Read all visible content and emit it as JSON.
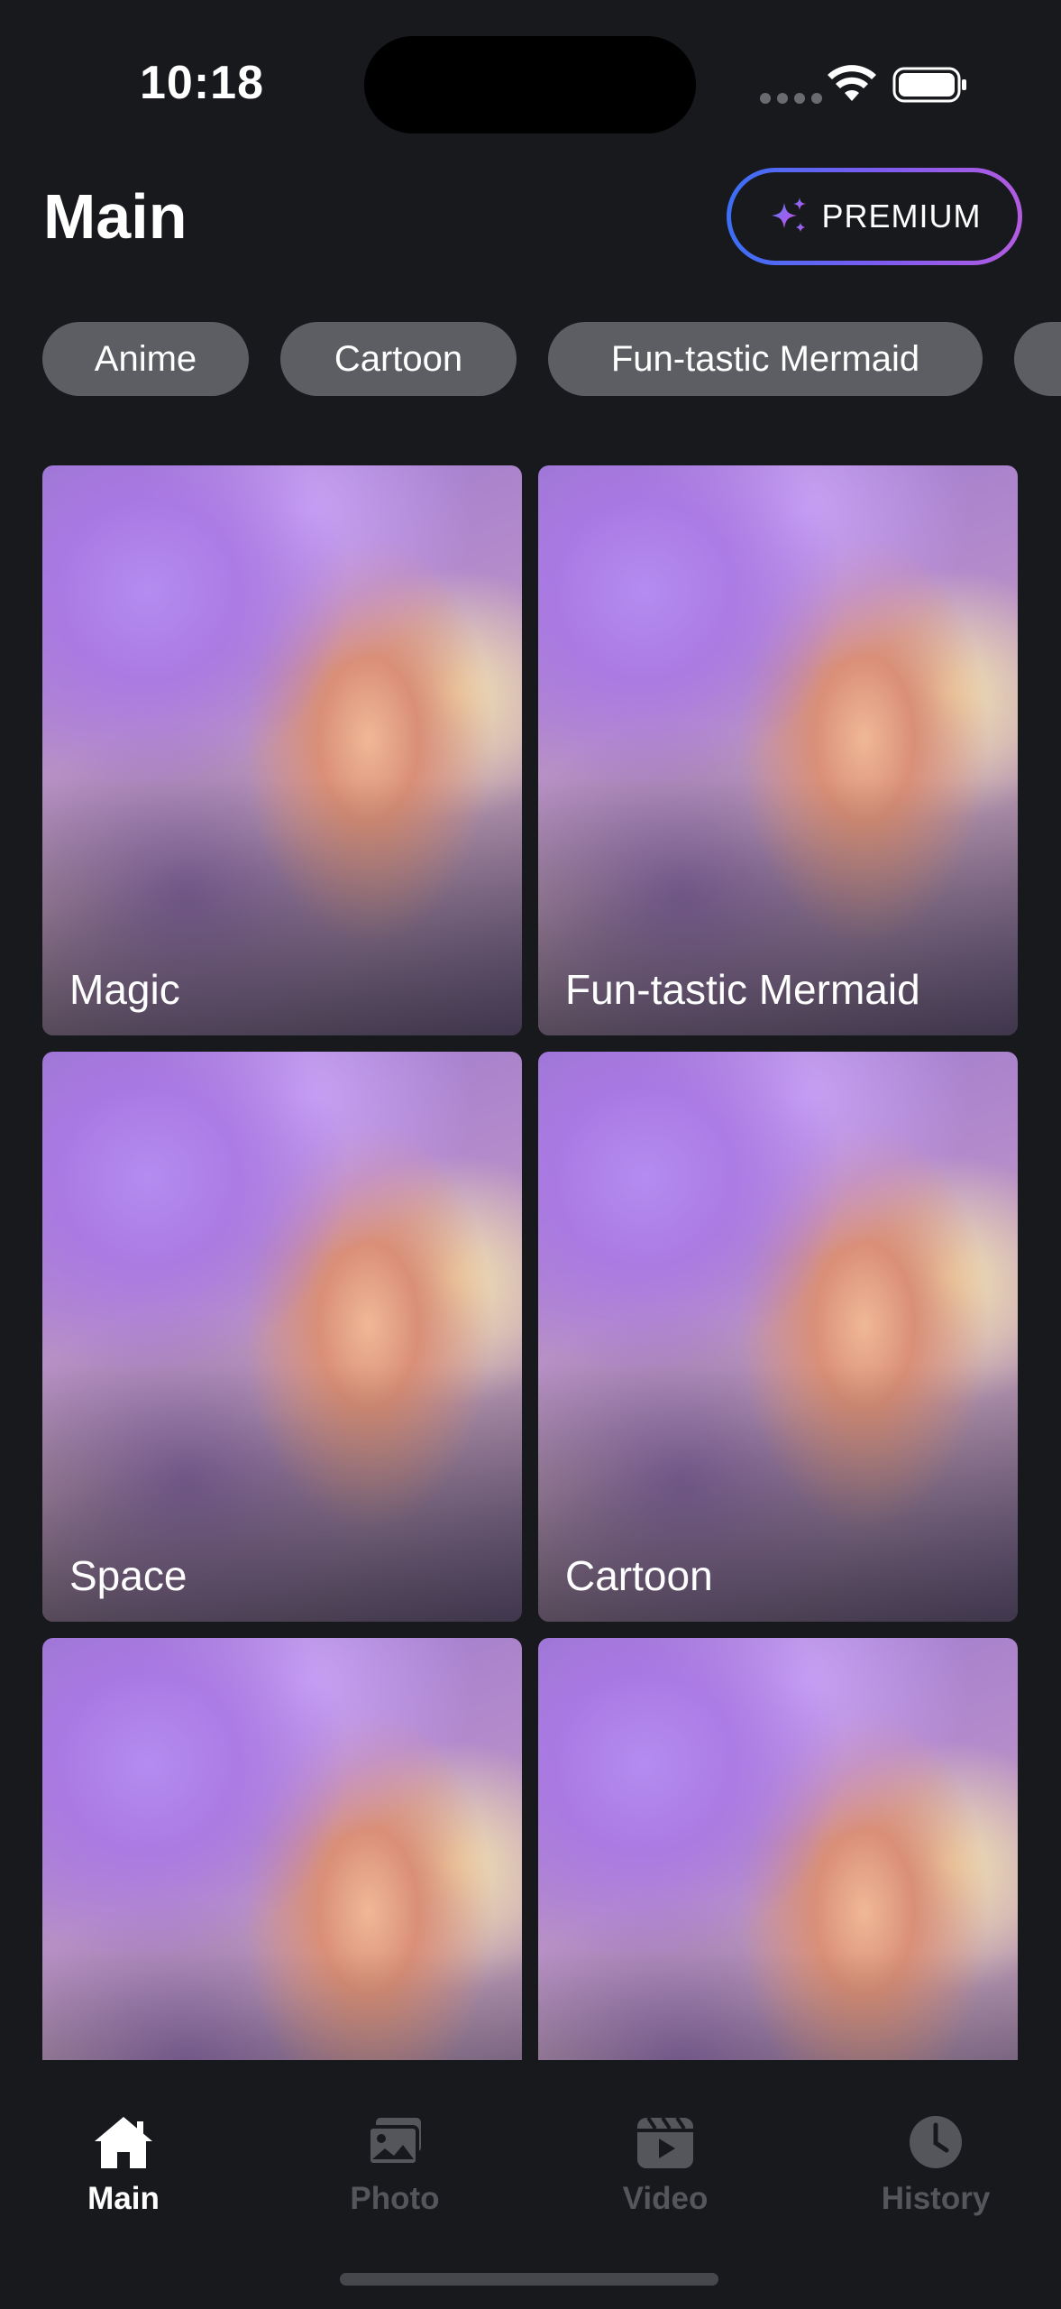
{
  "status_bar": {
    "time": "10:18"
  },
  "header": {
    "title": "Main",
    "premium_label": "PREMIUM"
  },
  "chips": [
    "Anime",
    "Cartoon",
    "Fun-tastic Mermaid",
    ""
  ],
  "cards": [
    "Magic",
    "Fun-tastic Mermaid",
    "Space",
    "Cartoon",
    "",
    ""
  ],
  "tabbar": {
    "tabs": [
      {
        "label": "Main",
        "icon": "house-icon",
        "active": true
      },
      {
        "label": "Photo",
        "icon": "photos-icon",
        "active": false
      },
      {
        "label": "Video",
        "icon": "video-clapper-icon",
        "active": false
      },
      {
        "label": "History",
        "icon": "clock-icon",
        "active": false
      }
    ]
  },
  "colors": {
    "background": "#18191d",
    "chip": "#5c5e63",
    "premium_gradient_start": "#3b6ff5",
    "premium_gradient_end": "#b35be0",
    "inactive_tab": "#55565b"
  }
}
